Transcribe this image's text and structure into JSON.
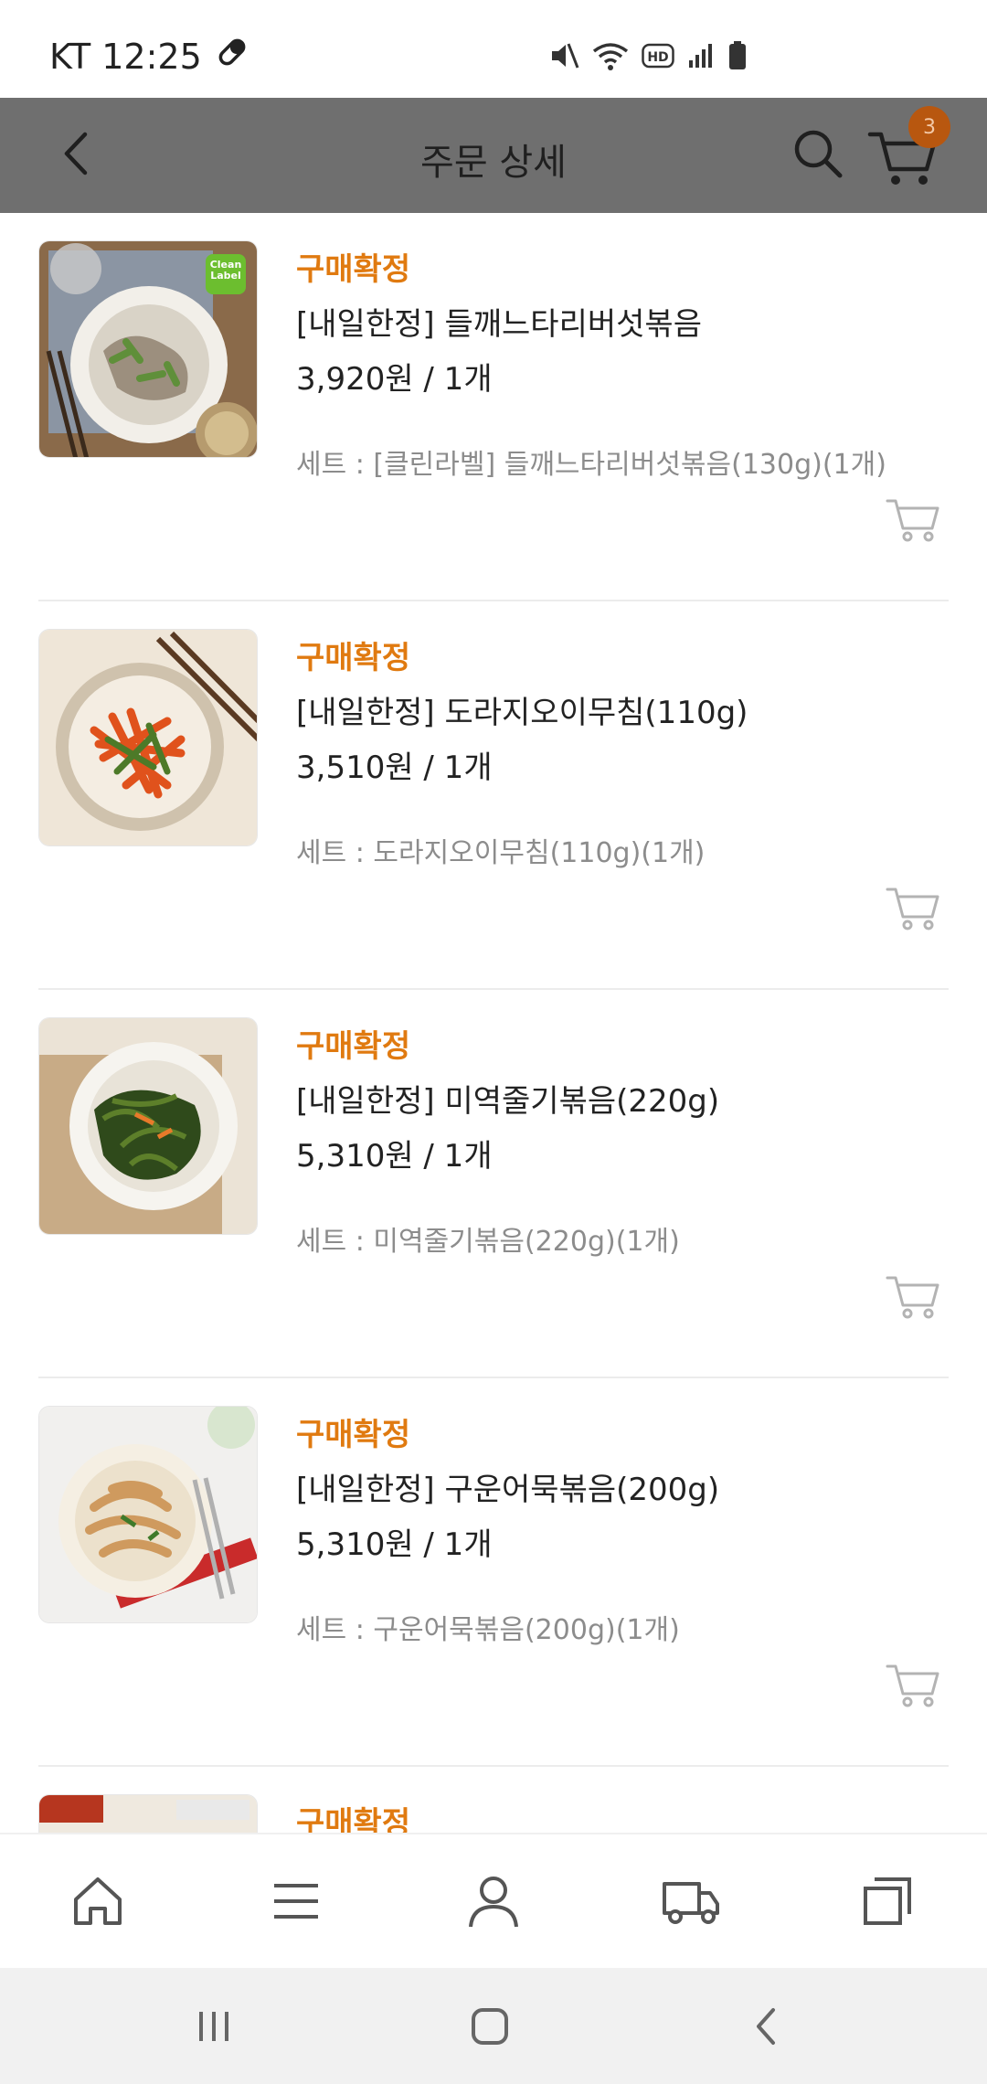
{
  "status_bar": {
    "carrier_time": "KT 12:25"
  },
  "header": {
    "title": "주문 상세",
    "cart_count": "3"
  },
  "orders": [
    {
      "status": "구매확정",
      "name": "[내일한정] 들깨느타리버섯볶음",
      "price_qty": "3,920원 / 1개",
      "set": "세트 : [클린라벨] 들깨느타리버섯볶음(130g)(1개)",
      "badge": "Clean Label"
    },
    {
      "status": "구매확정",
      "name": "[내일한정] 도라지오이무침(110g)",
      "price_qty": "3,510원 / 1개",
      "set": "세트 : 도라지오이무침(110g)(1개)"
    },
    {
      "status": "구매확정",
      "name": "[내일한정] 미역줄기볶음(220g)",
      "price_qty": "5,310원 / 1개",
      "set": "세트 : 미역줄기볶음(220g)(1개)"
    },
    {
      "status": "구매확정",
      "name": "[내일한정] 구운어묵볶음(200g)",
      "price_qty": "5,310원 / 1개",
      "set": "세트 : 구운어묵볶음(200g)(1개)"
    },
    {
      "status": "구매확정"
    }
  ],
  "colors": {
    "header_bg": "#6f6f6f",
    "status_orange": "#e07a10",
    "badge_bg": "#b8570f"
  },
  "icons": {
    "header": [
      "chevron-left-icon",
      "search-icon",
      "cart-icon"
    ],
    "bottom_nav": [
      "home-icon",
      "menu-icon",
      "user-icon",
      "truck-icon",
      "recent-icon"
    ],
    "system_nav": [
      "recents-icon",
      "home-icon",
      "back-icon"
    ]
  }
}
